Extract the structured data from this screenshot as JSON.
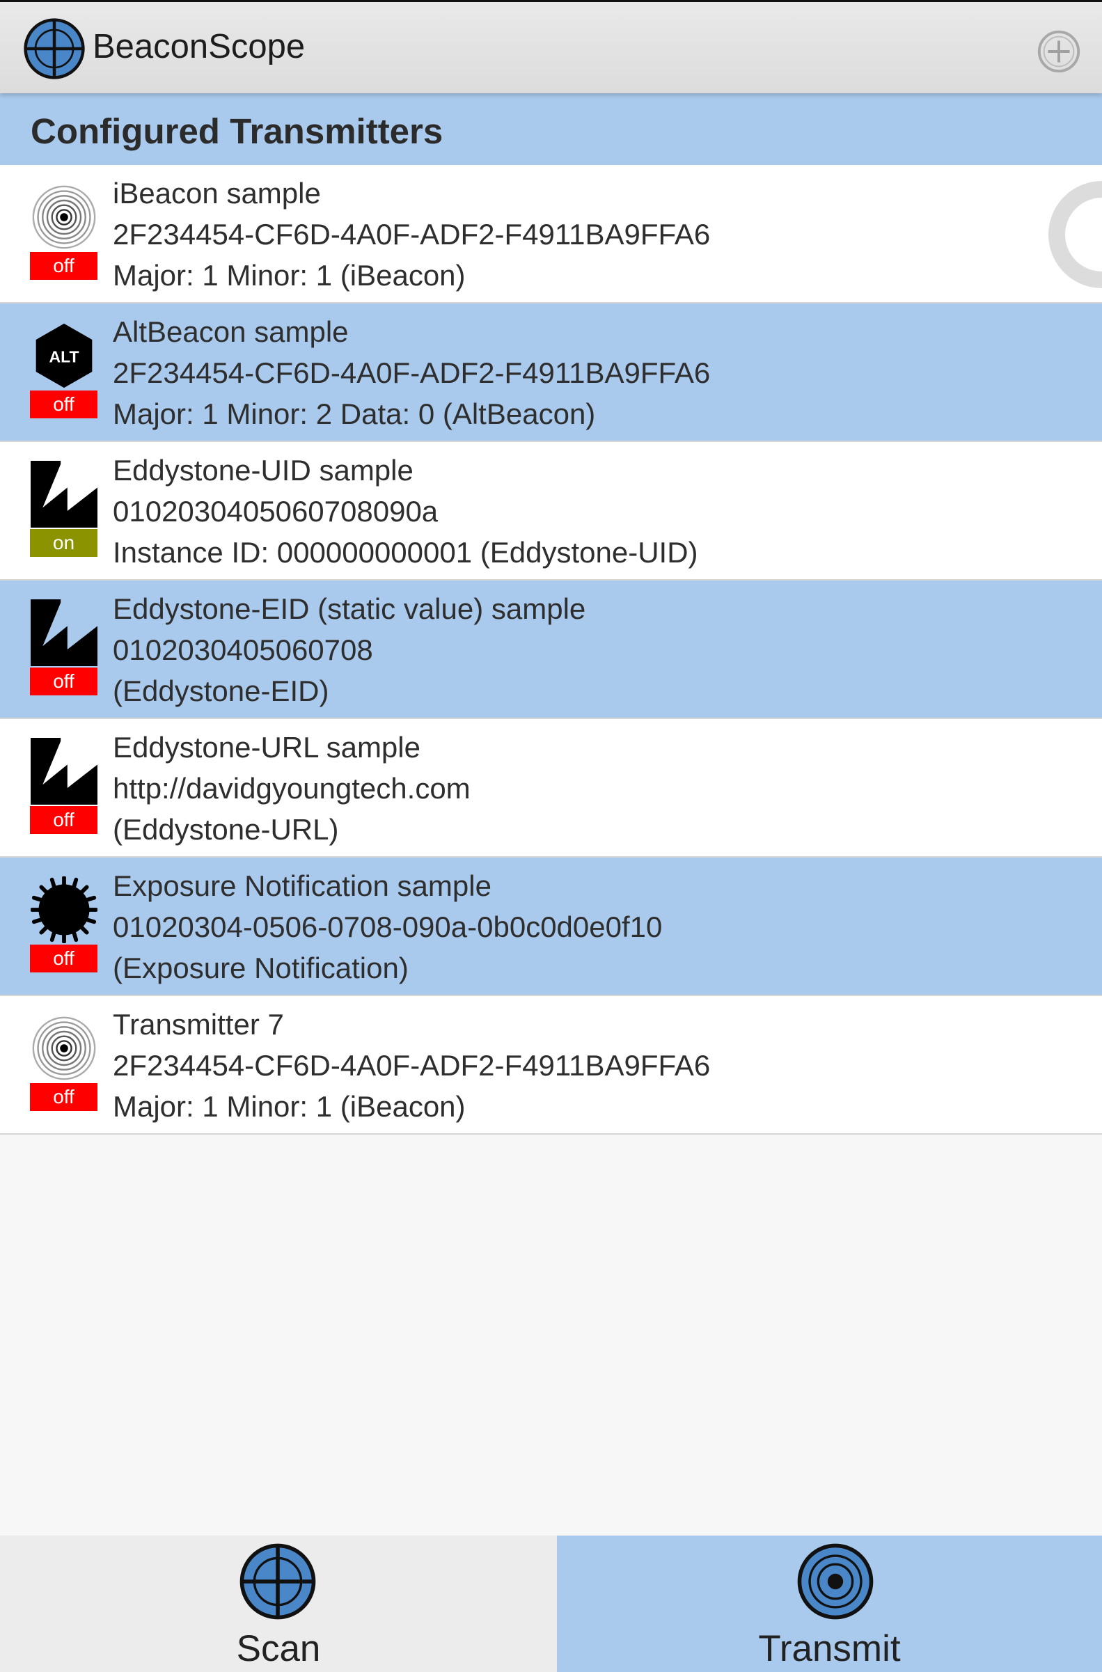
{
  "app": {
    "title": "BeaconScope",
    "icons": {
      "logo": "crosshair-globe-icon",
      "add": "add-circle-icon"
    }
  },
  "section": {
    "title": "Configured Transmitters"
  },
  "transmitters": [
    {
      "name": "iBeacon sample",
      "id": "2F234454-CF6D-4A0F-ADF2-F4911BA9FFA6",
      "details": "Major: 1  Minor: 1 (iBeacon)",
      "status": "off",
      "icon": "ibeacon-signal-icon"
    },
    {
      "name": "AltBeacon sample",
      "id": "2F234454-CF6D-4A0F-ADF2-F4911BA9FFA6",
      "details": "Major: 1  Minor: 2  Data: 0 (AltBeacon)",
      "status": "off",
      "icon": "altbeacon-icon",
      "icon_text": "ALT"
    },
    {
      "name": "Eddystone-UID sample",
      "id": "0102030405060708090a",
      "details": "Instance ID: 000000000001 (Eddystone-UID)",
      "status": "on",
      "icon": "eddystone-icon"
    },
    {
      "name": "Eddystone-EID (static value) sample",
      "id": "0102030405060708",
      "details": "(Eddystone-EID)",
      "status": "off",
      "icon": "eddystone-icon"
    },
    {
      "name": "Eddystone-URL sample",
      "id": "http://davidgyoungtech.com",
      "details": "(Eddystone-URL)",
      "status": "off",
      "icon": "eddystone-icon"
    },
    {
      "name": "Exposure Notification sample",
      "id": "01020304-0506-0708-090a-0b0c0d0e0f10",
      "details": "(Exposure Notification)",
      "status": "off",
      "icon": "exposure-notification-icon"
    },
    {
      "name": "Transmitter 7",
      "id": "2F234454-CF6D-4A0F-ADF2-F4911BA9FFA6",
      "details": "Major: 1  Minor: 1 (iBeacon)",
      "status": "off",
      "icon": "ibeacon-signal-icon"
    }
  ],
  "nav": {
    "scan_label": "Scan",
    "transmit_label": "Transmit",
    "active": "transmit",
    "icons": {
      "scan": "crosshair-globe-icon",
      "transmit": "transmit-rings-icon"
    }
  },
  "colors": {
    "highlight": "#a9c9ed",
    "status_off": "#ff0000",
    "status_on": "#8c9300",
    "topbar": "#e2e2e2"
  }
}
